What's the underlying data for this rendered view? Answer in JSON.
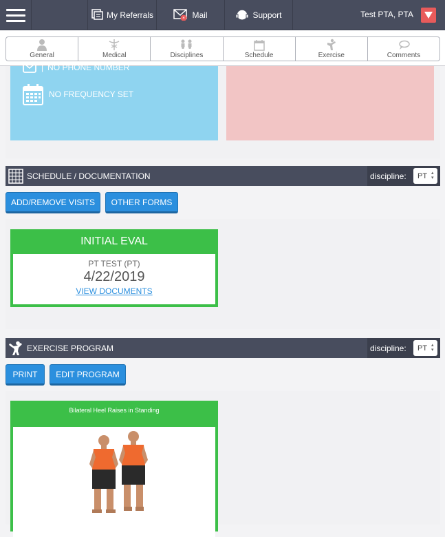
{
  "topbar": {
    "referrals_label": "My Referrals",
    "mail_label": "Mail",
    "support_label": "Support",
    "user_name": "Test PTA, PTA"
  },
  "tabs": [
    {
      "label": "General",
      "icon": "person-icon"
    },
    {
      "label": "Medical",
      "icon": "caduceus-icon"
    },
    {
      "label": "Disciplines",
      "icon": "people-icon"
    },
    {
      "label": "Schedule",
      "icon": "calendar-icon"
    },
    {
      "label": "Exercise",
      "icon": "exercise-icon"
    },
    {
      "label": "Comments",
      "icon": "speech-bubble-icon"
    }
  ],
  "info": {
    "phone": "NO PHONE NUMBER",
    "frequency": "NO FREQUENCY SET"
  },
  "schedule": {
    "title": "SCHEDULE / DOCUMENTATION",
    "discipline_label": "discipline:",
    "discipline_value": "PT",
    "add_remove_label": "ADD/REMOVE VISITS",
    "other_forms_label": "OTHER FORMS",
    "card": {
      "title": "INITIAL EVAL",
      "clinician": "PT TEST (PT)",
      "date": "4/22/2019",
      "link": "VIEW DOCUMENTS"
    }
  },
  "exercise": {
    "title": "EXERCISE PROGRAM",
    "discipline_label": "discipline:",
    "discipline_value": "PT",
    "print_label": "PRINT",
    "edit_label": "EDIT PROGRAM",
    "card_title": "Bilateral Heel Raises in Standing"
  },
  "colors": {
    "nav": "#484d5e",
    "accent_blue": "#2b8fde",
    "card_green": "#3cbf48",
    "info_blue": "#8fd4f0",
    "info_pink": "#f2c5c5",
    "alert_red": "#e85b5b"
  }
}
